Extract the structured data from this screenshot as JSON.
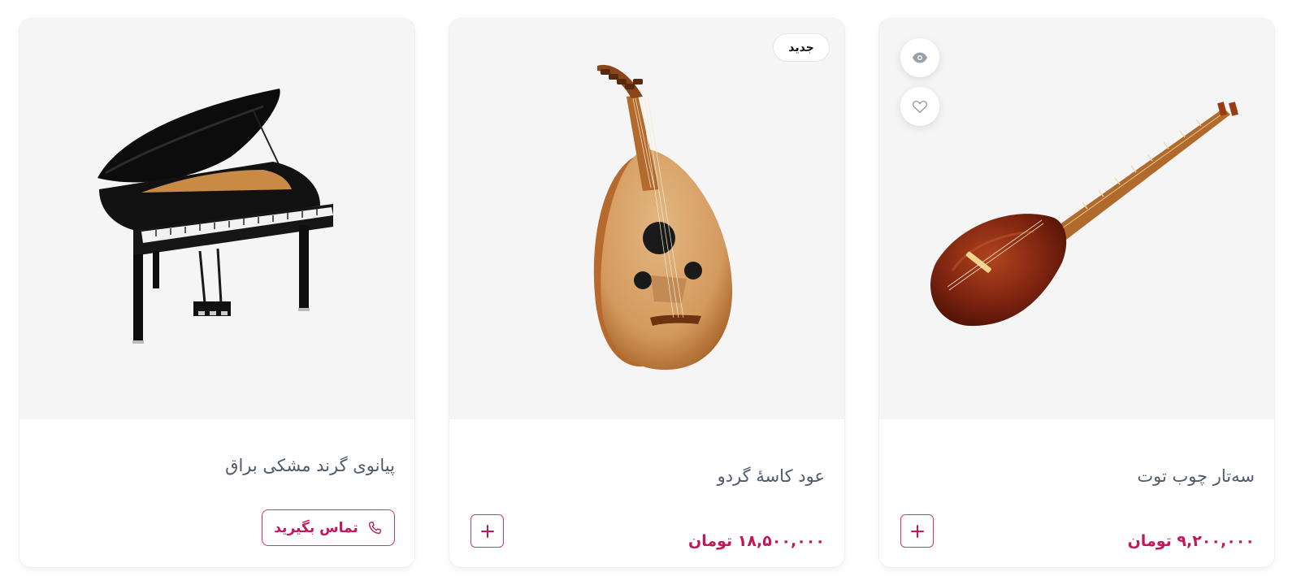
{
  "products": [
    {
      "title": "سه‌تار چوب توت",
      "price": "۹,۲۰۰,۰۰۰ تومان",
      "icons": [
        "eye-icon",
        "heart-icon",
        "plus-icon"
      ]
    },
    {
      "title": "عود کاسهٔ گردو",
      "price": "۱۸,۵۰۰,۰۰۰ تومان",
      "badge": "جدید",
      "icons": [
        "plus-icon"
      ]
    },
    {
      "title": "پیانوی گرند مشکی براق",
      "cta_label": "تماس بگیرید",
      "icons": [
        "phone-icon"
      ]
    }
  ],
  "colors": {
    "accent": "#c2185b",
    "title_text": "#4f5a6b",
    "media_bg": "#f5f5f5"
  }
}
